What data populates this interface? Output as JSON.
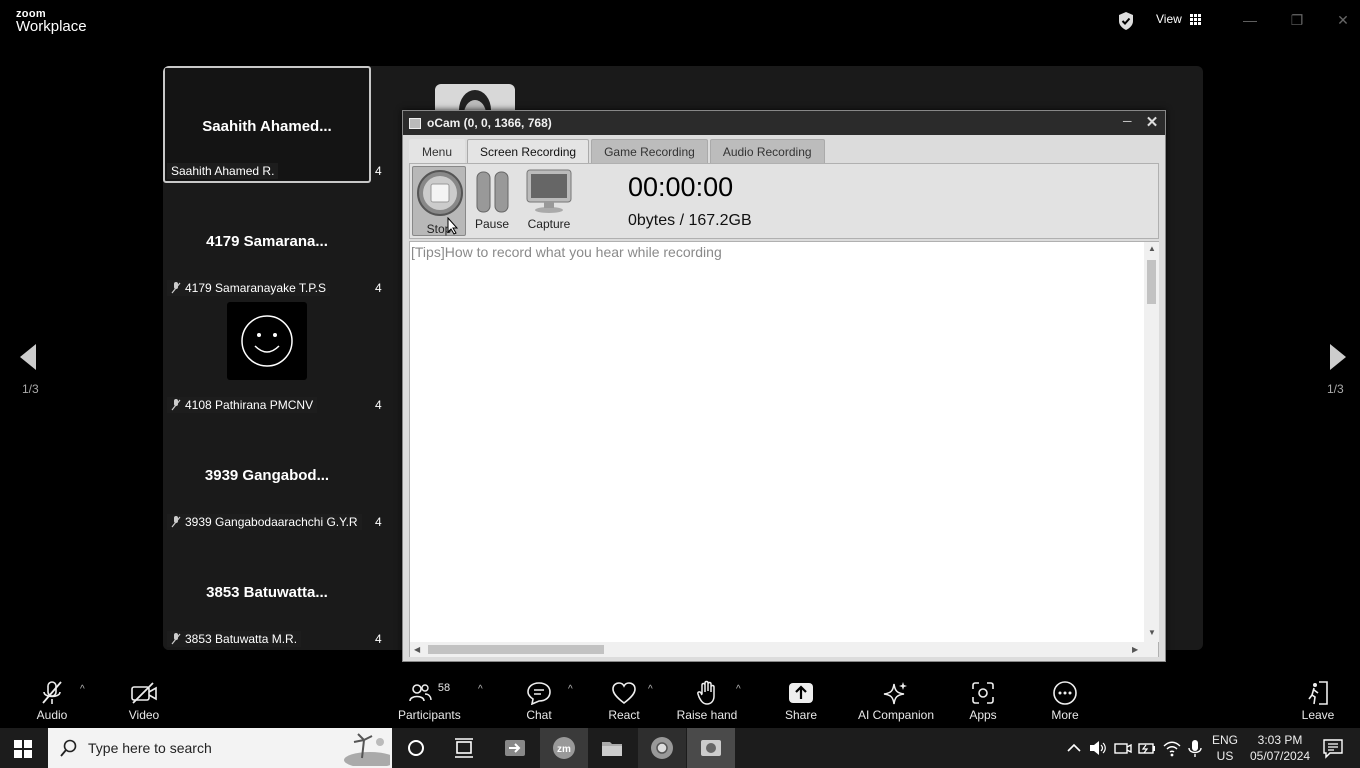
{
  "zoom": {
    "brand_top": "zoom",
    "brand_bottom": "Workplace",
    "view_label": "View",
    "page_left": "1/3",
    "page_right": "1/3"
  },
  "tiles": [
    {
      "title": "Saahith  Ahamed...",
      "name": "Saahith Ahamed R.",
      "active": true
    },
    {
      "title": "4179  Samarana...",
      "name": "4179 Samaranayake T.P.S"
    },
    {
      "title": "",
      "name": "4108 Pathirana PMCNV"
    },
    {
      "title": "3939  Gangabod...",
      "name": "3939 Gangabodaarachchi G.Y.R"
    },
    {
      "title": "3853  Batuwatta...",
      "name": "3853 Batuwatta M.R."
    }
  ],
  "col2_label": "4",
  "ocam": {
    "title": "oCam (0, 0, 1366, 768)",
    "tabs": [
      "Menu",
      "Screen Recording",
      "Game Recording",
      "Audio Recording"
    ],
    "stop_label": "Stop",
    "pause_label": "Pause",
    "capture_label": "Capture",
    "timer": "00:00:00",
    "bytes": "0bytes / 167.2GB",
    "tips": "[Tips]How to record what you hear while recording"
  },
  "toolbar": {
    "audio": "Audio",
    "video": "Video",
    "participants": "Participants",
    "participants_count": "58",
    "chat": "Chat",
    "react": "React",
    "raise_hand": "Raise hand",
    "share": "Share",
    "ai_companion": "AI Companion",
    "apps": "Apps",
    "more": "More",
    "leave": "Leave"
  },
  "taskbar": {
    "search_placeholder": "Type here to search",
    "lang_top": "ENG",
    "lang_bottom": "US",
    "time": "3:03 PM",
    "date": "05/07/2024"
  }
}
